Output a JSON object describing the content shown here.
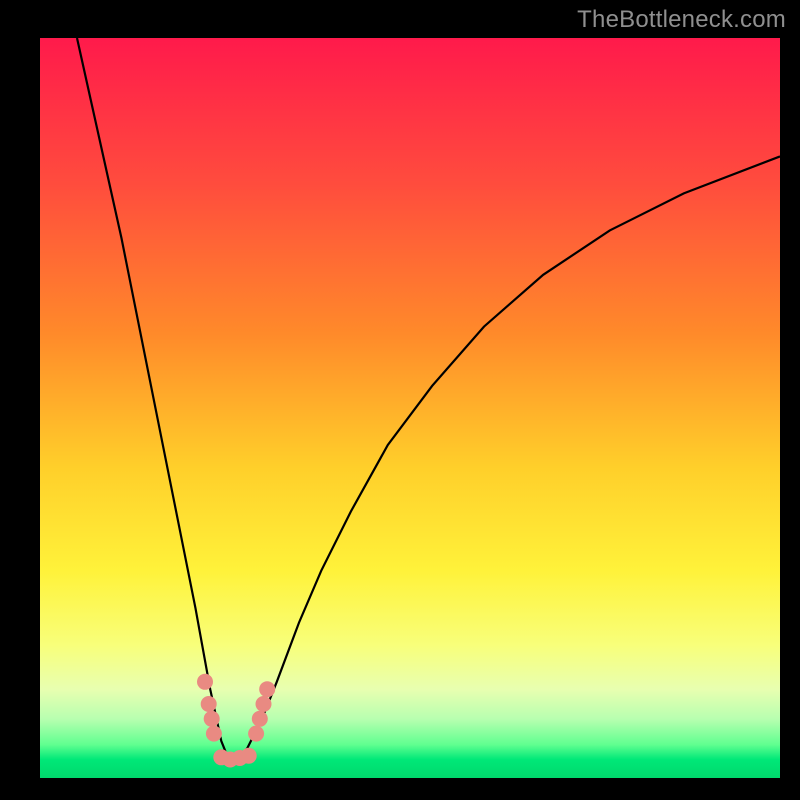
{
  "watermark": {
    "text": "TheBottleneck.com"
  },
  "chart_data": {
    "type": "line",
    "title": "",
    "xlabel": "",
    "ylabel": "",
    "xlim": [
      0,
      100
    ],
    "ylim": [
      0,
      100
    ],
    "gradient_stops": [
      {
        "offset": 0,
        "color": "#ff1a4b"
      },
      {
        "offset": 0.2,
        "color": "#ff4d3d"
      },
      {
        "offset": 0.4,
        "color": "#ff8a2a"
      },
      {
        "offset": 0.58,
        "color": "#ffcf2a"
      },
      {
        "offset": 0.72,
        "color": "#fff23a"
      },
      {
        "offset": 0.82,
        "color": "#f8ff7a"
      },
      {
        "offset": 0.88,
        "color": "#e8ffb0"
      },
      {
        "offset": 0.92,
        "color": "#b8ffb0"
      },
      {
        "offset": 0.955,
        "color": "#60ff90"
      },
      {
        "offset": 0.975,
        "color": "#00e878"
      },
      {
        "offset": 1.0,
        "color": "#00d86c"
      }
    ],
    "series": [
      {
        "name": "bottleneck-curve",
        "x": [
          5.0,
          7,
          9,
          11,
          13,
          15,
          17,
          19,
          21,
          23,
          24.5,
          25.5,
          26.5,
          28,
          30,
          32,
          35,
          38,
          42,
          47,
          53,
          60,
          68,
          77,
          87,
          100
        ],
        "y": [
          100,
          91,
          82,
          73,
          63,
          53,
          43,
          33,
          23,
          12,
          5,
          2.5,
          2.5,
          4,
          8,
          13,
          21,
          28,
          36,
          45,
          53,
          61,
          68,
          74,
          79,
          84
        ]
      }
    ],
    "markers": [
      {
        "x": 22.3,
        "y": 13.0
      },
      {
        "x": 22.8,
        "y": 10.0
      },
      {
        "x": 23.2,
        "y": 8.0
      },
      {
        "x": 23.5,
        "y": 6.0
      },
      {
        "x": 24.5,
        "y": 2.8
      },
      {
        "x": 25.7,
        "y": 2.5
      },
      {
        "x": 27.0,
        "y": 2.7
      },
      {
        "x": 28.2,
        "y": 3.0
      },
      {
        "x": 29.2,
        "y": 6.0
      },
      {
        "x": 29.7,
        "y": 8.0
      },
      {
        "x": 30.2,
        "y": 10.0
      },
      {
        "x": 30.7,
        "y": 12.0
      }
    ]
  }
}
